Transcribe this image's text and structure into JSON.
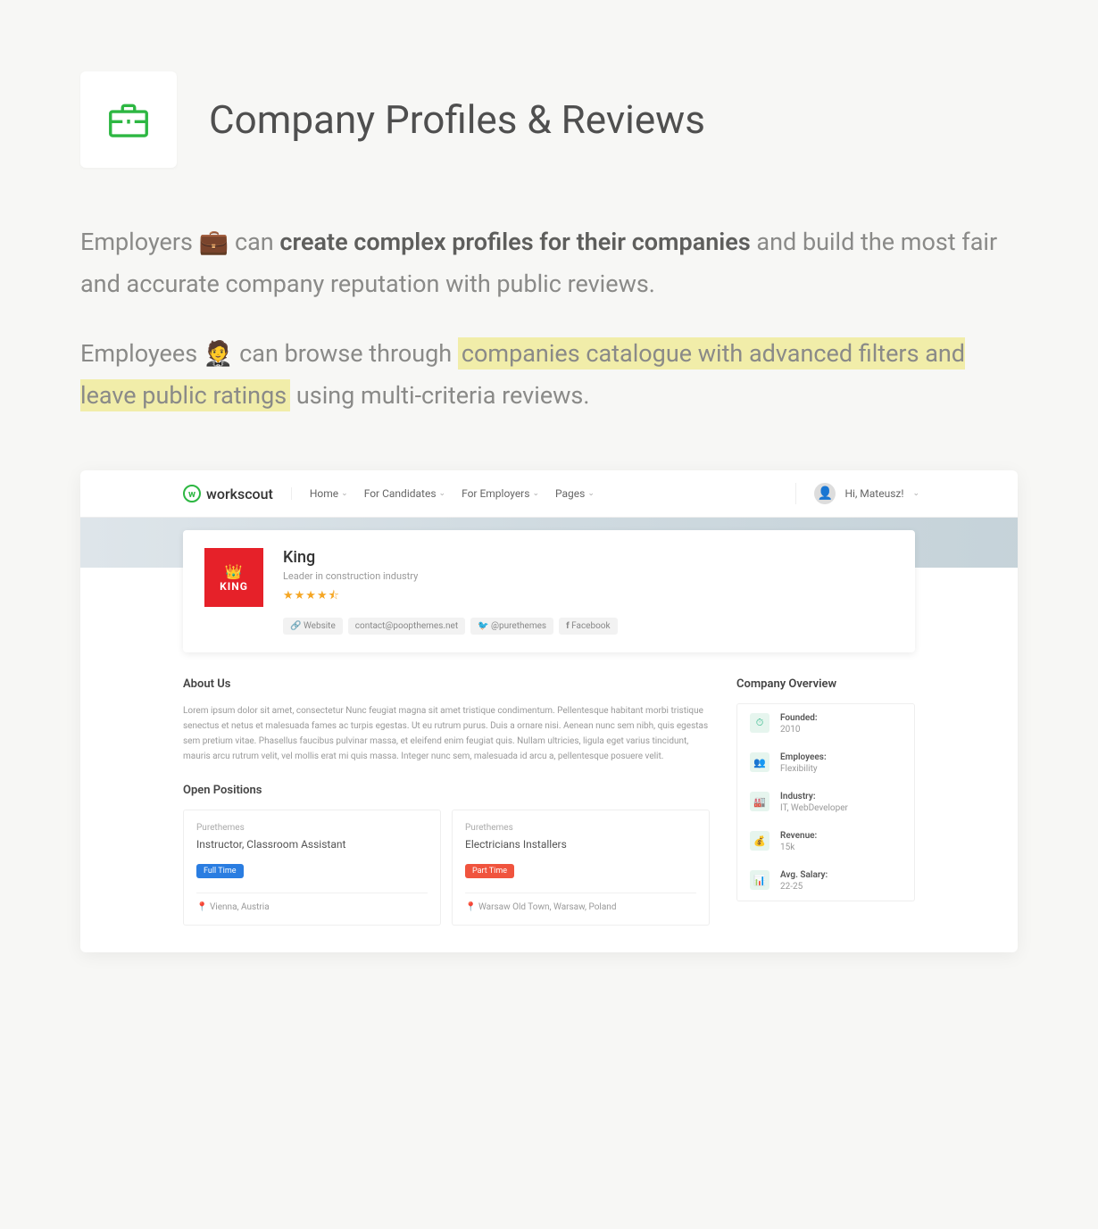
{
  "header": {
    "title": "Company Profiles & Reviews"
  },
  "paragraph1": {
    "prefix": "Employers ",
    "emoji": "💼",
    "connector": " can ",
    "strong": "create complex profiles for their companies",
    "suffix": " and build the most fair and accurate company reputation with public reviews."
  },
  "paragraph2": {
    "prefix": "Employees ",
    "emoji": "🤵",
    "connector": " can browse through ",
    "highlight": "companies catalogue with advanced filters and leave public ratings",
    "suffix": " using multi-criteria reviews."
  },
  "workscout": {
    "logo": "workscout",
    "nav": [
      "Home",
      "For Candidates",
      "For Employers",
      "Pages"
    ],
    "user": "Hi, Mateusz!",
    "company": {
      "name": "King",
      "tagline": "Leader in construction industry",
      "logo_text": "KING",
      "stars": "★★★★⯪",
      "badges": [
        {
          "icon": "🔗",
          "text": "Website"
        },
        {
          "icon": "",
          "text": "contact@poopthemes.net"
        },
        {
          "icon": "🐦",
          "text": "@purethemes"
        },
        {
          "icon": "f",
          "text": "Facebook"
        }
      ]
    },
    "about": {
      "title": "About Us",
      "text": "Lorem ipsum dolor sit amet, consectetur Nunc feugiat magna sit amet tristique condimentum. Pellentesque habitant morbi tristique senectus et netus et malesuada fames ac turpis egestas. Ut eu rutrum purus. Duis a ornare nisi. Aenean nunc sem nibh, quis egestas sem pretium vitae. Phasellus faucibus pulvinar massa, et eleifend enim feugiat quis. Nullam ultricies, ligula eget varius tincidunt, mauris arcu rutrum velit, vel mollis erat mi quis massa. Integer nunc sem, malesuada id arcu a, pellentesque posuere velit."
    },
    "positions": {
      "title": "Open Positions",
      "items": [
        {
          "company": "Purethemes",
          "title": "Instructor, Classroom Assistant",
          "type": "Full Time",
          "type_class": "ws-fulltime",
          "location": "Vienna, Austria"
        },
        {
          "company": "Purethemes",
          "title": "Electricians Installers",
          "type": "Part Time",
          "type_class": "ws-parttime",
          "location": "Warsaw Old Town, Warsaw, Poland"
        }
      ]
    },
    "overview": {
      "title": "Company Overview",
      "items": [
        {
          "icon": "⏱",
          "label": "Founded:",
          "value": "2010"
        },
        {
          "icon": "👥",
          "label": "Employees:",
          "value": "Flexibility"
        },
        {
          "icon": "🏭",
          "label": "Industry:",
          "value": "IT, WebDeveloper"
        },
        {
          "icon": "💰",
          "label": "Revenue:",
          "value": "15k"
        },
        {
          "icon": "📊",
          "label": "Avg. Salary:",
          "value": "22-25"
        }
      ]
    }
  }
}
